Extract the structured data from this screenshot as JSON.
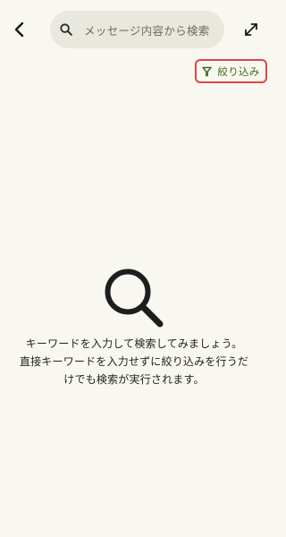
{
  "header": {
    "search": {
      "placeholder": "メッセージ内容から検索"
    }
  },
  "filter": {
    "label": "絞り込み",
    "accent_color": "#3f6a22",
    "highlight_color": "#e04545"
  },
  "empty_state": {
    "lines": [
      "キーワードを入力して検索してみましょう。",
      "直接キーワードを入力せずに絞り込みを行うだ",
      "けでも検索が実行されます。"
    ]
  },
  "colors": {
    "background": "#f9f8f0",
    "search_field": "#e9e8df"
  }
}
